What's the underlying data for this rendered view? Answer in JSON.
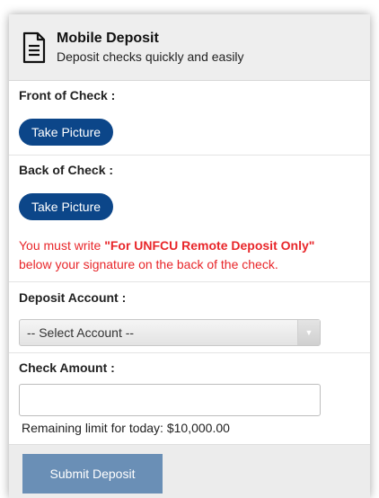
{
  "header": {
    "title": "Mobile Deposit",
    "subtitle": "Deposit checks quickly and easily",
    "icon": "document-icon"
  },
  "front": {
    "label": "Front of Check :",
    "button_label": "Take Picture"
  },
  "back": {
    "label": "Back of Check :",
    "button_label": "Take Picture"
  },
  "warning": {
    "prefix": "You must write ",
    "emphasis": "\"For UNFCU Remote Deposit Only\"",
    "suffix": "below your signature on the back of the check."
  },
  "account": {
    "label": "Deposit Account :",
    "selected": "-- Select Account --"
  },
  "amount": {
    "label": "Check Amount :",
    "value": "",
    "limit_text": "Remaining limit for today: $10,000.00"
  },
  "footer": {
    "submit_label": "Submit Deposit"
  },
  "colors": {
    "primary_button": "#0c4689",
    "submit_button": "#6a8fb6",
    "warning_text": "#e8262a"
  }
}
